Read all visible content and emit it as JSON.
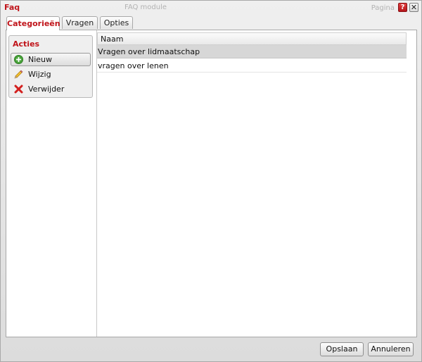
{
  "window": {
    "title": "Faq",
    "ghost_title": "FAQ module",
    "ghost_right": "Pagina",
    "help_label": "?",
    "close_label": "✕"
  },
  "tabs": [
    {
      "label": "Categorieën",
      "active": true
    },
    {
      "label": "Vragen",
      "active": false
    },
    {
      "label": "Opties",
      "active": false
    }
  ],
  "sidebar": {
    "title": "Acties",
    "actions": [
      {
        "label": "Nieuw",
        "icon": "add-icon"
      },
      {
        "label": "Wijzig",
        "icon": "pencil-icon"
      },
      {
        "label": "Verwijder",
        "icon": "delete-icon"
      }
    ]
  },
  "grid": {
    "columns": [
      "Naam"
    ],
    "rows": [
      {
        "naam": "Vragen over lidmaatschap",
        "selected": true
      },
      {
        "naam": "vragen over lenen",
        "selected": false
      }
    ]
  },
  "footer": {
    "save_label": "Opslaan",
    "cancel_label": "Annuleren"
  },
  "colors": {
    "accent": "#c0141a",
    "selected_row": "#d7d7d7",
    "panel": "#efefef"
  }
}
